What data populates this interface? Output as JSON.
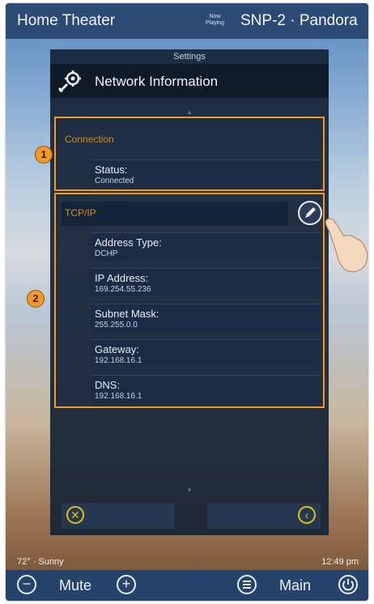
{
  "top_bar": {
    "room": "Home Theater",
    "now_playing_line1": "Now",
    "now_playing_line2": "Playing",
    "source": "SNP-2 · Pandora"
  },
  "panel": {
    "settings_label": "Settings",
    "title": "Network Information",
    "icon": "gear-wrench-icon"
  },
  "connection": {
    "section_title": "Connection",
    "callout": "1",
    "status_label": "Status:",
    "status_value": "Connected"
  },
  "tcpip": {
    "section_title": "TCP/IP",
    "callout": "2",
    "edit_icon": "pencil-icon",
    "fields": [
      {
        "label": "Address Type:",
        "value": "DCHP"
      },
      {
        "label": "IP Address:",
        "value": "169.254.55.236"
      },
      {
        "label": "Subnet Mask:",
        "value": "255.255.0.0"
      },
      {
        "label": "Gateway:",
        "value": "192.168.16.1"
      },
      {
        "label": "DNS:",
        "value": "192.168.16.1"
      }
    ]
  },
  "buttons": {
    "cancel_icon": "close-circle-icon",
    "back_icon": "chevron-left-circle-icon"
  },
  "status_bar": {
    "weather": "72° · Sunny",
    "time": "12:49 pm"
  },
  "bottom_bar": {
    "mute_label": "Mute",
    "main_label": "Main",
    "volume_down_icon": "minus-icon",
    "volume_up_icon": "plus-icon",
    "menu_icon": "menu-icon",
    "power_icon": "power-icon"
  },
  "colors": {
    "highlight": "#f39a24",
    "section_title": "#d88a1c",
    "button_icon": "#d8c21c",
    "bar": "#25436b"
  }
}
